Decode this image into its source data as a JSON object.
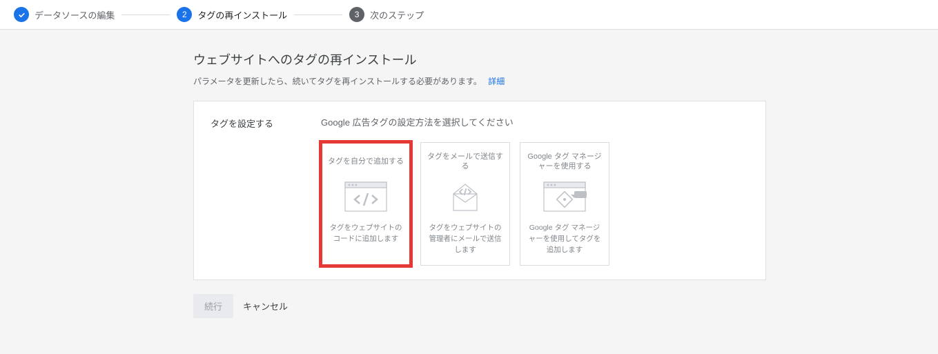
{
  "stepper": {
    "steps": [
      {
        "label": "データソースの編集",
        "state": "done"
      },
      {
        "label": "タグの再インストール",
        "state": "active",
        "num": "2"
      },
      {
        "label": "次のステップ",
        "state": "future",
        "num": "3"
      }
    ]
  },
  "page": {
    "title": "ウェブサイトへのタグの再インストール",
    "subtitle": "パラメータを更新したら、続いてタグを再インストールする必要があります。",
    "details_link": "詳細"
  },
  "card": {
    "left_label": "タグを設定する",
    "instruction": "Google 広告タグの設定方法を選択してください",
    "options": [
      {
        "title": "タグを自分で追加する",
        "desc": "タグをウェブサイトのコードに追加します",
        "highlight": true,
        "icon": "code-window"
      },
      {
        "title": "タグをメールで送信する",
        "desc": "タグをウェブサイトの管理者にメールで送信します",
        "highlight": false,
        "icon": "mail-code"
      },
      {
        "title": "Google タグ マネージャーを使用する",
        "desc": "Google タグ マネージャーを使用してタグを追加します",
        "highlight": false,
        "icon": "tag-manager"
      }
    ]
  },
  "actions": {
    "continue": "続行",
    "cancel": "キャンセル"
  }
}
